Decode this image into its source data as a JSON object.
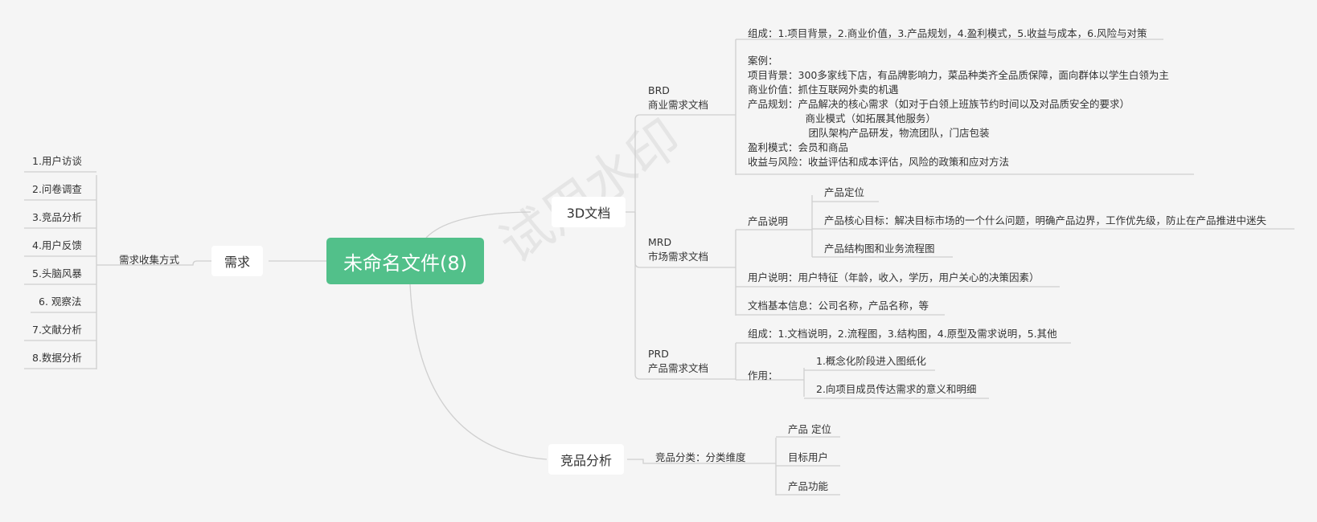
{
  "root": "未命名文件(8)",
  "watermark": "试用水印",
  "xuqiu": {
    "label": "需求",
    "method_label": "需求收集方式",
    "items": [
      "1.用户访谈",
      "2.问卷调查",
      "3.竞品分析",
      "4.用户反馈",
      "5.头脑风暴",
      "6. 观察法",
      "7.文献分析",
      "8.数据分析"
    ]
  },
  "docs3d": {
    "label": "3D文档",
    "brd": {
      "title": "BRD",
      "subtitle": "商业需求文档",
      "composition": "组成：1.项目背景，2.商业价值，3.产品规划，4.盈利模式，5.收益与成本，6.风险与对策",
      "case_lines": [
        "案例：",
        "项目背景：300多家线下店，有品牌影响力，菜品种类齐全品质保障，面向群体以学生白领为主",
        "商业价值：抓住互联网外卖的机遇",
        "产品规划：产品解决的核心需求（如对于白领上班族节约时间以及对品质安全的要求）",
        "                  商业模式（如拓展其他服务）",
        "                   团队架构产品研发，物流团队，门店包装",
        "盈利模式：会员和商品",
        "收益与风险：收益评估和成本评估，风险的政策和应对方法"
      ]
    },
    "mrd": {
      "title": "MRD",
      "subtitle": "市场需求文档",
      "product_desc": "产品说明",
      "product_items": [
        "产品定位",
        "产品核心目标：解决目标市场的一个什么问题，明确产品边界，工作优先级，防止在产品推进中迷失",
        "产品结构图和业务流程图"
      ],
      "user_desc": "用户说明：用户特征（年龄，收入，学历，用户关心的决策因素）",
      "doc_info": "文档基本信息：公司名称，产品名称，等"
    },
    "prd": {
      "title": "PRD",
      "subtitle": "产品需求文档",
      "composition": "组成：1.文档说明，2.流程图，3.结构图，4.原型及需求说明，5.其他",
      "role_label": "作用：",
      "role_items": [
        "1.概念化阶段进入图纸化",
        "2.向项目成员传达需求的意义和明细"
      ]
    }
  },
  "competitor": {
    "label": "竞品分析",
    "category_label": "竞品分类：分类维度",
    "items": [
      "产品 定位",
      "目标用户",
      "产品功能"
    ]
  },
  "colors": {
    "root_bg": "#52c08a",
    "line": "#c8c8c8",
    "background": "#f5f5f5"
  }
}
